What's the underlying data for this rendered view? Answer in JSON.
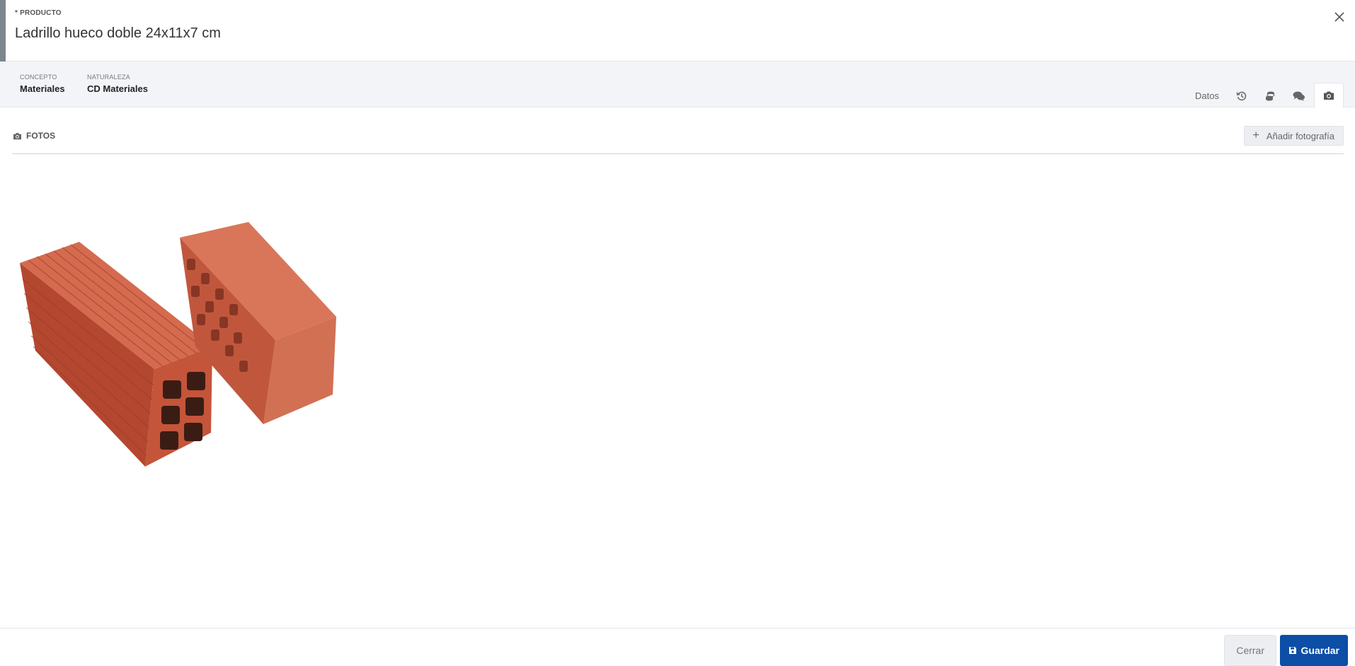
{
  "header": {
    "kicker": "* PRODUCTO",
    "title": "Ladrillo hueco doble 24x11x7 cm",
    "close_icon": "close-icon"
  },
  "info": {
    "fields": [
      {
        "label": "CONCEPTO",
        "value": "Materiales"
      },
      {
        "label": "NATURALEZA",
        "value": "CD Materiales"
      }
    ]
  },
  "tabs": {
    "items": [
      {
        "label": "Datos",
        "icon": null,
        "active": false
      },
      {
        "label": "",
        "icon": "history-icon",
        "active": false
      },
      {
        "label": "",
        "icon": "coins-icon",
        "active": false
      },
      {
        "label": "",
        "icon": "comments-icon",
        "active": false
      },
      {
        "label": "",
        "icon": "camera-icon",
        "active": true
      }
    ]
  },
  "photos": {
    "section_title": "FOTOS",
    "add_label": "Añadir fotografía",
    "image_alt": "two-clay-bricks-photo"
  },
  "footer": {
    "close_label": "Cerrar",
    "save_label": "Guardar"
  },
  "colors": {
    "primary": "#0d4ea6",
    "accent_bar": "#7c868d",
    "infobar_bg": "#f3f4f7",
    "brick": "#c8553c"
  }
}
